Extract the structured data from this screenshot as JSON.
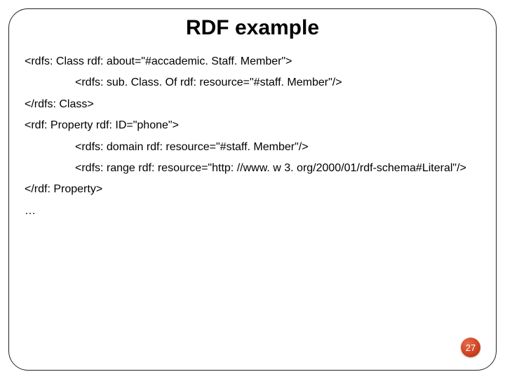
{
  "slide": {
    "title": "RDF example",
    "code_lines": [
      {
        "text": "<rdfs: Class rdf: about=\"#accademic. Staff. Member\">",
        "indent": false
      },
      {
        "text": "<rdfs: sub. Class. Of rdf: resource=\"#staff. Member\"/>",
        "indent": true
      },
      {
        "text": "</rdfs: Class>",
        "indent": false
      },
      {
        "text": "<rdf: Property rdf: ID=\"phone\">",
        "indent": false
      },
      {
        "text": "<rdfs: domain rdf: resource=\"#staff. Member\"/>",
        "indent": true
      },
      {
        "text": "<rdfs: range rdf: resource=\"http: //www. w 3. org/2000/01/rdf-schema#Literal\"/>",
        "indent": true
      },
      {
        "text": "</rdf: Property>",
        "indent": false
      },
      {
        "text": "…",
        "indent": false
      }
    ],
    "page_number": "27"
  }
}
